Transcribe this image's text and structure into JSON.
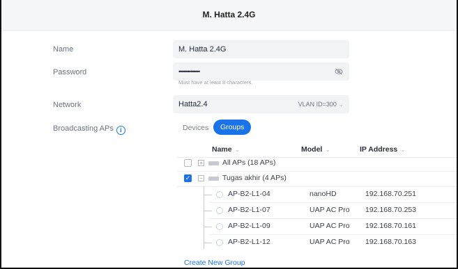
{
  "header": {
    "title": "M. Hatta 2.4G"
  },
  "form": {
    "name_label": "Name",
    "name_value": "M. Hatta 2.4G",
    "password_label": "Password",
    "password_value": "••••••••••••••",
    "password_hint": "Must have at least 8 characters.",
    "network_label": "Network",
    "network_value": "Hatta2.4",
    "vlan_text": "VLAN ID=300",
    "broadcasting_label": "Broadcasting APs"
  },
  "tabs": {
    "devices": "Devices",
    "groups": "Groups",
    "active": "Groups"
  },
  "table": {
    "columns": {
      "name": "Name",
      "model": "Model",
      "ip": "IP Address"
    },
    "groups": [
      {
        "label": "All APs (18 APs)",
        "checked": false,
        "expanded": false
      },
      {
        "label": "Tugas akhir (4 APs)",
        "checked": true,
        "expanded": true
      }
    ],
    "aps": [
      {
        "name": "AP-B2-L1-04",
        "model": "nanoHD",
        "ip": "192.168.70.251"
      },
      {
        "name": "AP-B2-L1-07",
        "model": "UAP AC Pro",
        "ip": "192.168.70.253"
      },
      {
        "name": "AP-B2-L1-09",
        "model": "UAP AC Pro",
        "ip": "192.168.70.161"
      },
      {
        "name": "AP-B2-L1-12",
        "model": "UAP AC Pro",
        "ip": "192.168.70.163"
      }
    ]
  },
  "actions": {
    "create_group": "Create New Group"
  },
  "colors": {
    "accent": "#1a73e8",
    "field_bg": "#f2f3f5",
    "header_bg": "#f6f7f8"
  }
}
